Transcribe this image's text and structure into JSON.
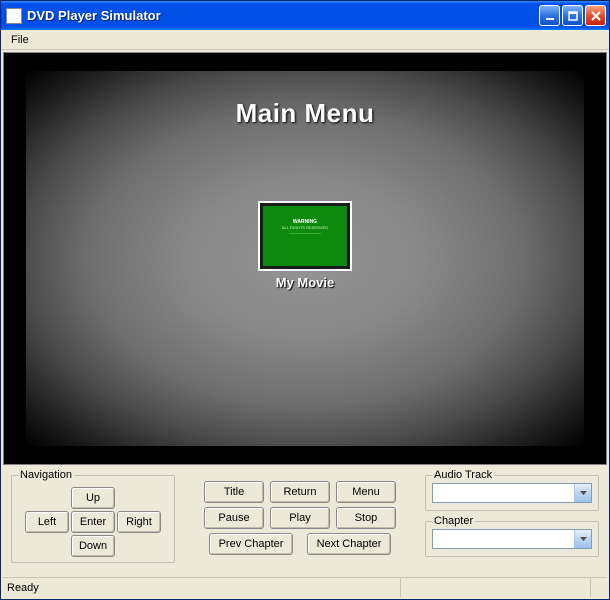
{
  "titlebar": {
    "icon": "app-icon",
    "title": "DVD Player Simulator"
  },
  "menubar": {
    "file": "File"
  },
  "dvdmenu": {
    "title": "Main Menu",
    "thumb_label": "My Movie"
  },
  "nav": {
    "legend": "Navigation",
    "up": "Up",
    "left": "Left",
    "enter": "Enter",
    "right": "Right",
    "down": "Down"
  },
  "playback": {
    "title": "Title",
    "return": "Return",
    "menu": "Menu",
    "pause": "Pause",
    "play": "Play",
    "stop": "Stop",
    "prev_chapter": "Prev Chapter",
    "next_chapter": "Next Chapter"
  },
  "audio": {
    "legend": "Audio Track",
    "value": ""
  },
  "chapter": {
    "legend": "Chapter",
    "value": ""
  },
  "status": {
    "text": "Ready"
  }
}
